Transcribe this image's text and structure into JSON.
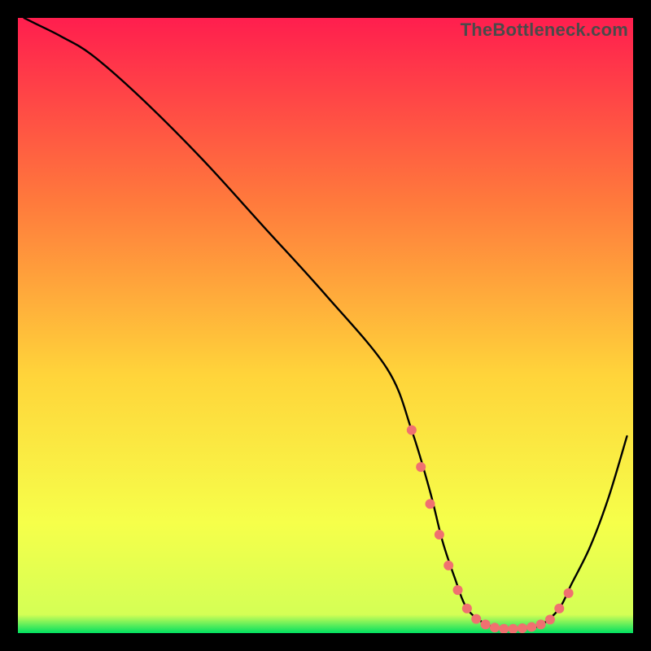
{
  "watermark": "TheBottleneck.com",
  "colors": {
    "bg_black": "#000000",
    "grad_top": "#ff1e4e",
    "grad_mid1": "#ff7a3c",
    "grad_mid2": "#ffd43a",
    "grad_mid3": "#f6ff4a",
    "grad_bottom": "#00e060",
    "line": "#000000",
    "marker": "#f07070"
  },
  "chart_data": {
    "type": "line",
    "title": "",
    "xlabel": "",
    "ylabel": "",
    "xlim": [
      0,
      100
    ],
    "ylim": [
      0,
      100
    ],
    "series": [
      {
        "name": "curve",
        "x": [
          1,
          3,
          7,
          12,
          20,
          30,
          40,
          50,
          60,
          64,
          67,
          69,
          71,
          73,
          76,
          79,
          82,
          85,
          88,
          90,
          93,
          96,
          99
        ],
        "y": [
          100,
          99,
          97,
          94,
          87,
          77,
          66,
          55,
          43,
          33,
          23,
          15,
          9,
          4,
          1.5,
          0.7,
          0.7,
          1.3,
          4,
          8,
          14,
          22,
          32
        ]
      }
    ],
    "markers": {
      "name": "highlight-points",
      "x": [
        64,
        65.5,
        67,
        68.5,
        70,
        71.5,
        73,
        74.5,
        76,
        77.5,
        79,
        80.5,
        82,
        83.5,
        85,
        86.5,
        88,
        89.5
      ],
      "y": [
        33,
        27,
        21,
        16,
        11,
        7,
        4,
        2.3,
        1.4,
        0.9,
        0.7,
        0.7,
        0.8,
        1.0,
        1.4,
        2.2,
        4,
        6.5
      ]
    }
  }
}
